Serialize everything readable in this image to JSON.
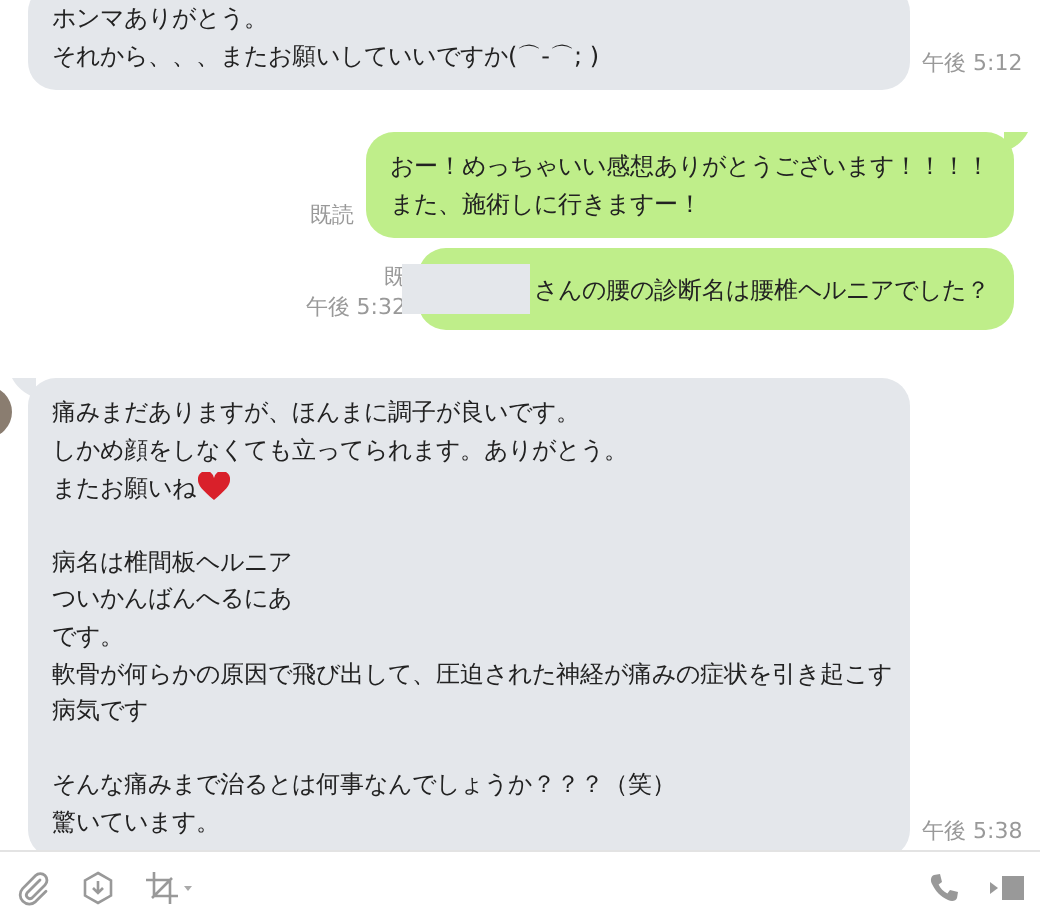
{
  "messages": [
    {
      "kind": "incoming",
      "paragraphs": [
        [
          {
            "text": "ホンマありがとう。"
          },
          {
            "text": "それから、、、またお願いしていいですか(⌒-⌒; )"
          }
        ]
      ],
      "time": "午後 5:12"
    },
    {
      "kind": "outgoing",
      "paragraphs": [
        [
          {
            "text": "おー！めっちゃいい感想ありがとうございます！！！！"
          },
          {
            "text": "また、施術しに行きますー！"
          }
        ]
      ],
      "read": "既読",
      "tail": true
    },
    {
      "kind": "outgoing",
      "redacted": true,
      "paragraphs": [
        [
          {
            "text": "さんの腰の診断名は腰椎ヘルニアでした？"
          }
        ]
      ],
      "read": "既",
      "time": "午後 5:32"
    },
    {
      "kind": "incoming",
      "avatar": true,
      "tail": true,
      "paragraphs": [
        [
          {
            "text": "痛みまだありますが、ほんまに調子が良いです。"
          },
          {
            "text": "しかめ顔をしなくても立ってられます。ありがとう。"
          },
          {
            "text": "またお願いね",
            "kind": "with_heart"
          }
        ],
        [
          {
            "text": "病名は椎間板ヘルニア"
          },
          {
            "text": "ついかんばんへるにあ"
          },
          {
            "text": "です。"
          },
          {
            "text": "軟骨が何らかの原因で飛び出して、圧迫された神経が痛みの症状を引き起こす"
          },
          {
            "text": "病気です"
          }
        ],
        [
          {
            "text": "そんな痛みまで治るとは何事なんでしょうか？？？（笑）"
          },
          {
            "text": "驚いています。"
          }
        ]
      ],
      "time": "午後 5:38"
    }
  ],
  "toolbar": {
    "left": [
      {
        "kind": "attach"
      },
      {
        "kind": "download"
      },
      {
        "kind": "crop"
      }
    ],
    "right": [
      {
        "kind": "call"
      },
      {
        "kind": "video"
      }
    ]
  }
}
